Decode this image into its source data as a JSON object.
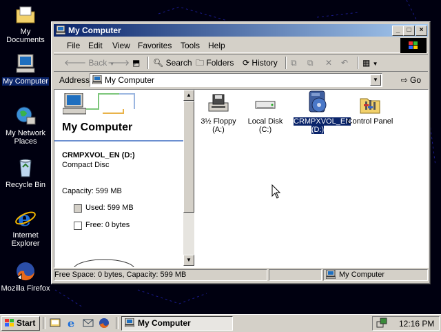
{
  "desktop": {
    "icons": [
      {
        "label": "My Documents"
      },
      {
        "label": "My Computer"
      },
      {
        "label": "My Network Places"
      },
      {
        "label": "Recycle Bin"
      },
      {
        "label": "Internet Explorer"
      },
      {
        "label": "Mozilla Firefox"
      }
    ]
  },
  "window": {
    "title": "My Computer",
    "menu": [
      "File",
      "Edit",
      "View",
      "Favorites",
      "Tools",
      "Help"
    ],
    "toolbar": {
      "back": "Back",
      "search": "Search",
      "folders": "Folders",
      "history": "History"
    },
    "address": {
      "label": "Address",
      "value": "My Computer",
      "go": "Go"
    },
    "left_pane": {
      "heading": "My Computer",
      "drive_name": "CRMPXVOL_EN (D:)",
      "drive_type": "Compact Disc",
      "capacity": "Capacity: 599 MB",
      "used": "Used: 599 MB",
      "free": "Free: 0 bytes"
    },
    "items": [
      {
        "label": "3½ Floppy (A:)",
        "icon": "floppy-drive-icon"
      },
      {
        "label": "Local Disk (C:)",
        "icon": "hard-disk-icon"
      },
      {
        "label": "CRMPXVOL_EN (D:)",
        "icon": "cd-drive-icon",
        "selected": true
      },
      {
        "label": "Control Panel",
        "icon": "control-panel-icon"
      }
    ],
    "status": {
      "left": "Free Space: 0 bytes, Capacity: 599 MB",
      "right": "My Computer"
    }
  },
  "taskbar": {
    "start": "Start",
    "task": "My Computer",
    "clock": "12:16 PM"
  },
  "colors": {
    "selection": "#0a246a",
    "face": "#d4d0c8",
    "desktop": "#000010"
  }
}
